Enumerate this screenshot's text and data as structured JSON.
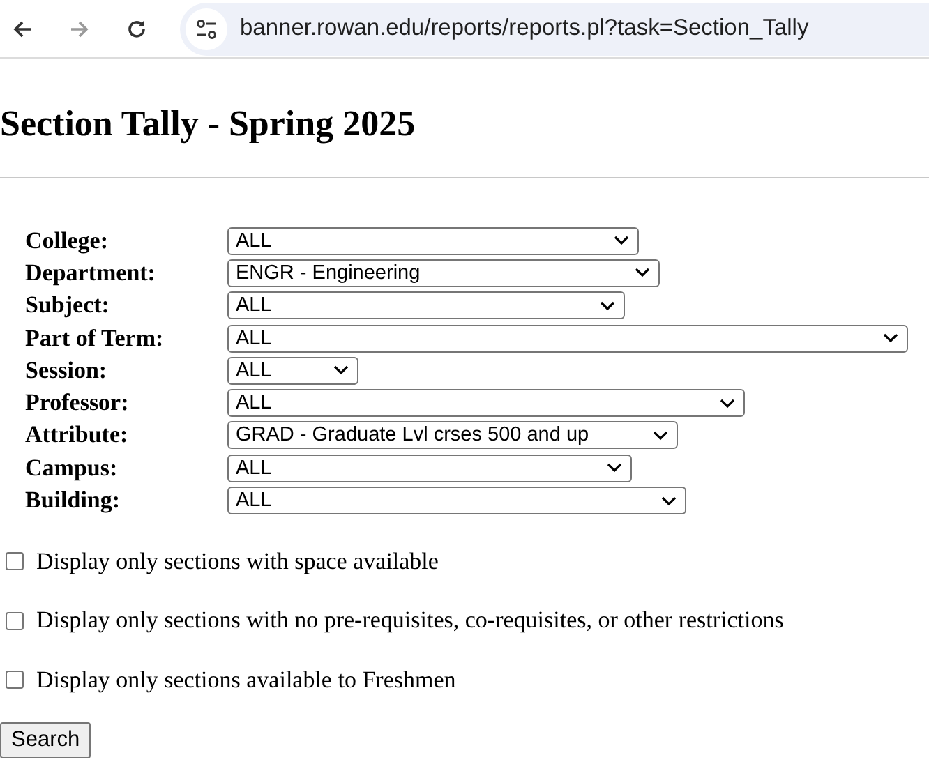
{
  "browser": {
    "url": "banner.rowan.edu/reports/reports.pl?task=Section_Tally"
  },
  "title": "Section Tally - Spring 2025",
  "filters": [
    {
      "label": "College:",
      "value": "ALL"
    },
    {
      "label": "Department:",
      "value": "ENGR - Engineering"
    },
    {
      "label": "Subject:",
      "value": "ALL"
    },
    {
      "label": "Part of Term:",
      "value": "ALL"
    },
    {
      "label": "Session:",
      "value": "ALL"
    },
    {
      "label": "Professor:",
      "value": "ALL"
    },
    {
      "label": "Attribute:",
      "value": "GRAD - Graduate Lvl crses 500 and up"
    },
    {
      "label": "Campus:",
      "value": "ALL"
    },
    {
      "label": "Building:",
      "value": "ALL"
    }
  ],
  "options": [
    {
      "label": "Display only sections with space available",
      "checked": false
    },
    {
      "label": "Display only sections with no pre-requisites, co-requisites, or other restrictions",
      "checked": false
    },
    {
      "label": "Display only sections available to Freshmen",
      "checked": false
    }
  ],
  "button": "Search"
}
